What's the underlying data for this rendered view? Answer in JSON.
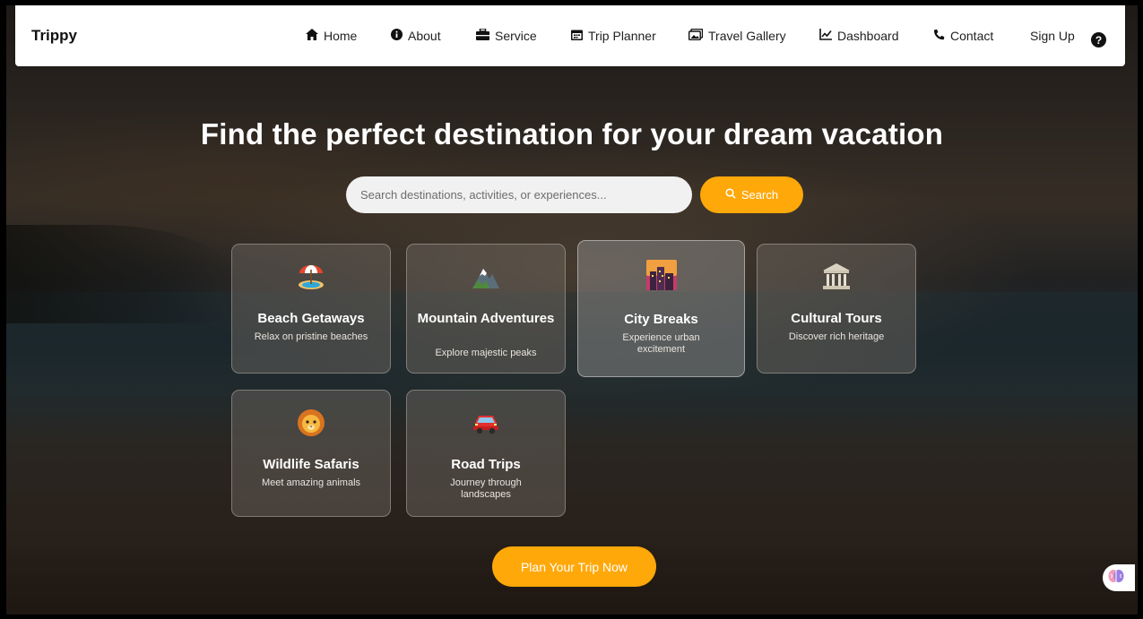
{
  "brand": "Trippy",
  "nav": [
    {
      "label": "Home",
      "icon": "home-icon",
      "glyph": "🏠"
    },
    {
      "label": "About",
      "icon": "info-icon",
      "glyph": "ℹ"
    },
    {
      "label": "Service",
      "icon": "toolbox-icon",
      "glyph": "💼"
    },
    {
      "label": "Trip Planner",
      "icon": "calendar-icon",
      "glyph": "📅"
    },
    {
      "label": "Travel Gallery",
      "icon": "images-icon",
      "glyph": "🖼"
    },
    {
      "label": "Dashboard",
      "icon": "chart-line-icon",
      "glyph": "📈"
    },
    {
      "label": "Contact",
      "icon": "phone-icon",
      "glyph": "📞"
    },
    {
      "label": "Sign Up"
    }
  ],
  "help_glyph": "?",
  "hero": {
    "title": "Find the perfect destination for your dream vacation",
    "search_placeholder": "Search destinations, activities, or experiences...",
    "search_button": "Search",
    "search_icon": "🔍"
  },
  "categories": [
    {
      "title": "Beach Getaways",
      "description": "Relax on pristine beaches",
      "icon": "beach-umbrella-icon",
      "glyph": "🏖"
    },
    {
      "title": "Mountain Adventures",
      "description": "Explore majestic peaks",
      "icon": "mountain-icon",
      "glyph": "🏔"
    },
    {
      "title": "City Breaks",
      "description": "Experience urban excitement",
      "icon": "cityscape-icon",
      "glyph": "🌆"
    },
    {
      "title": "Cultural Tours",
      "description": "Discover rich heritage",
      "icon": "classical-building-icon",
      "glyph": "🏛"
    },
    {
      "title": "Wildlife Safaris",
      "description": "Meet amazing animals",
      "icon": "lion-icon",
      "glyph": "🦁"
    },
    {
      "title": "Road Trips",
      "description": "Journey through landscapes",
      "icon": "car-icon",
      "glyph": "🚗"
    }
  ],
  "cta": "Plan Your Trip Now",
  "assistant_icon": "brain-icon",
  "colors": {
    "accent": "#ffa80a",
    "nav_bg": "#ffffff"
  }
}
